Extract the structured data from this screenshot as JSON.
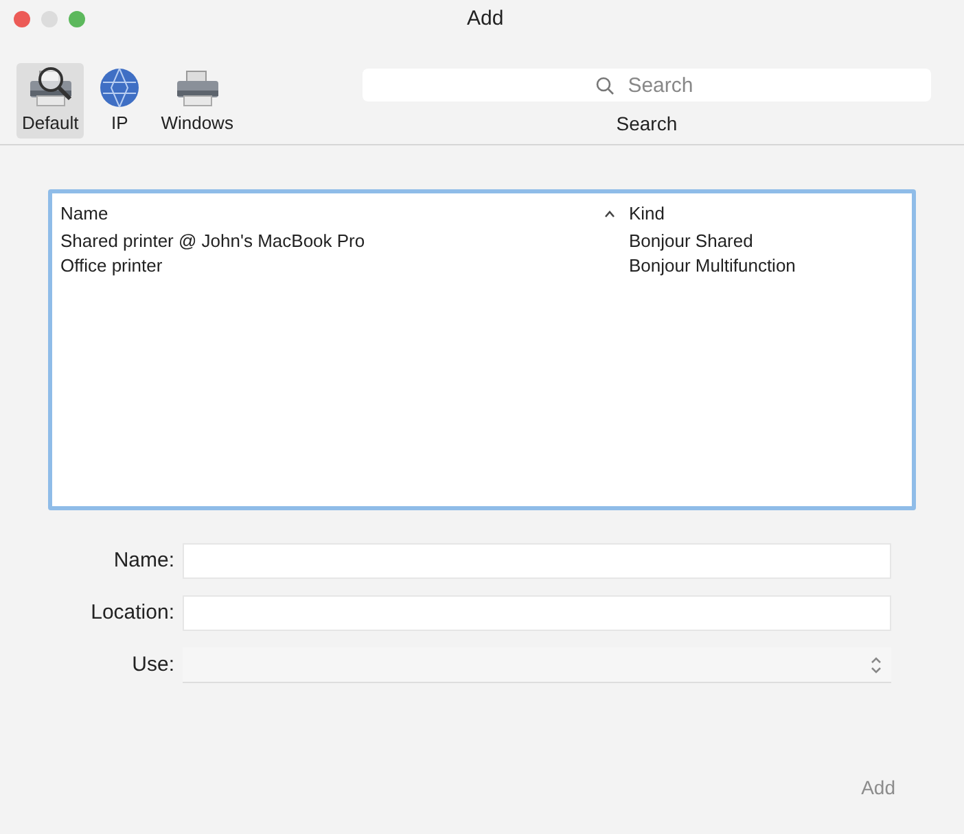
{
  "window": {
    "title": "Add"
  },
  "toolbar": {
    "items": [
      {
        "label": "Default",
        "kind": "default",
        "selected": true
      },
      {
        "label": "IP",
        "kind": "ip",
        "selected": false
      },
      {
        "label": "Windows",
        "kind": "windows",
        "selected": false
      }
    ]
  },
  "search": {
    "placeholder": "Search",
    "label": "Search"
  },
  "table": {
    "columns": [
      {
        "label": "Name",
        "sorted": true
      },
      {
        "label": "Kind",
        "sorted": false
      }
    ],
    "rows": [
      {
        "cells": [
          "Shared printer @ John's MacBook Pro",
          "Bonjour Shared"
        ]
      },
      {
        "cells": [
          "Office printer",
          "Bonjour Multifunction"
        ]
      }
    ]
  },
  "form": {
    "fields": [
      {
        "label": "Name:",
        "kind": "text"
      },
      {
        "label": "Location:",
        "kind": "text"
      },
      {
        "label": "Use:",
        "kind": "select"
      }
    ]
  },
  "add_button": {
    "label": "Add",
    "disabled": true
  }
}
